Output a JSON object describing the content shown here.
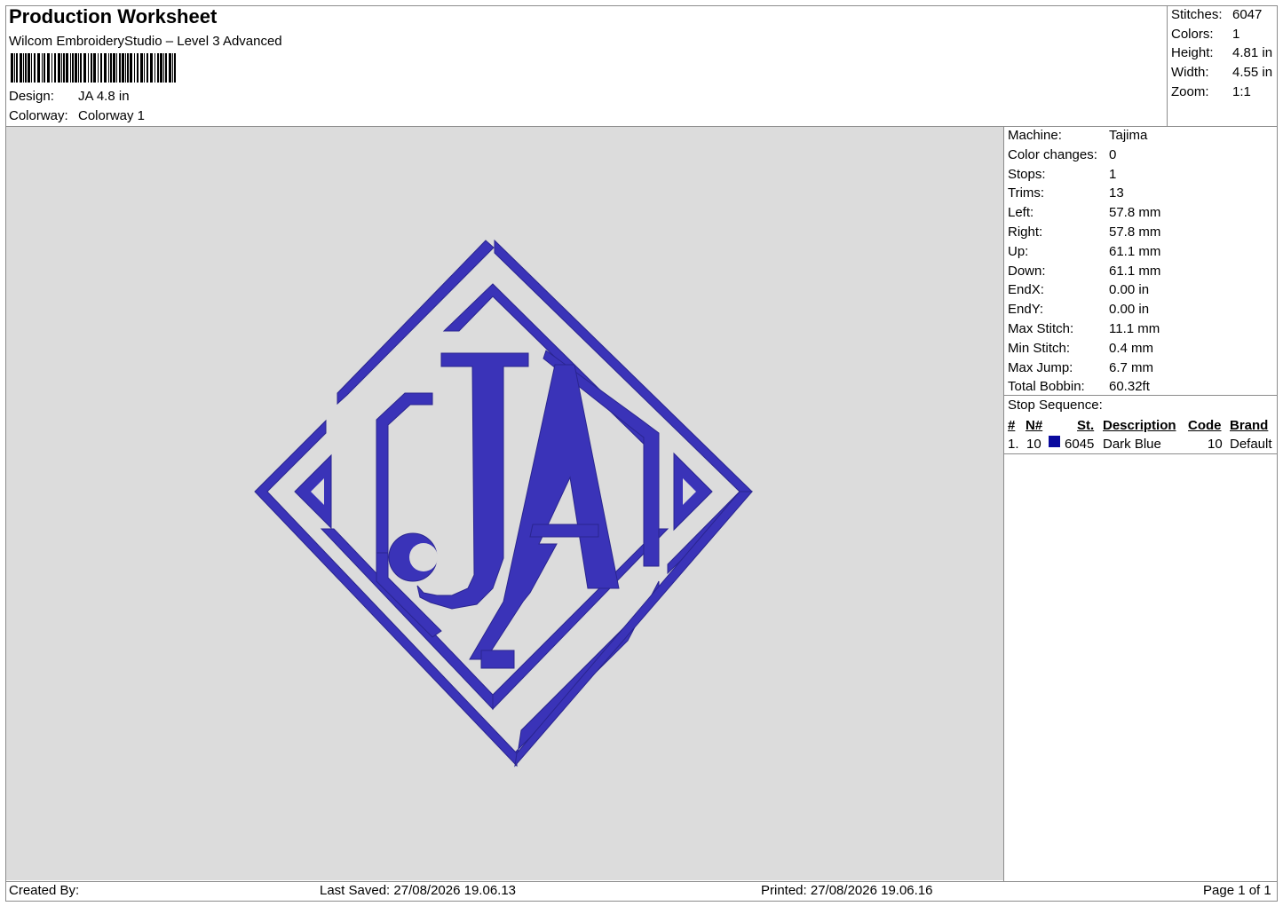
{
  "header": {
    "title": "Production Worksheet",
    "subtitle": "Wilcom EmbroideryStudio – Level 3 Advanced",
    "design_label": "Design:",
    "design_value": "JA 4.8 in",
    "colorway_label": "Colorway:",
    "colorway_value": "Colorway 1"
  },
  "stats": [
    {
      "label": "Stitches:",
      "value": "6047"
    },
    {
      "label": "Colors:",
      "value": "1"
    },
    {
      "label": "Height:",
      "value": "4.81 in"
    },
    {
      "label": "Width:",
      "value": "4.55 in"
    },
    {
      "label": "Zoom:",
      "value": "1:1"
    }
  ],
  "properties": [
    {
      "label": "Machine:",
      "value": "Tajima"
    },
    {
      "label": "Color changes:",
      "value": "0"
    },
    {
      "label": "Stops:",
      "value": "1"
    },
    {
      "label": "Trims:",
      "value": "13"
    },
    {
      "label": "Left:",
      "value": "57.8 mm"
    },
    {
      "label": "Right:",
      "value": "57.8 mm"
    },
    {
      "label": "Up:",
      "value": "61.1 mm"
    },
    {
      "label": "Down:",
      "value": "61.1 mm"
    },
    {
      "label": "EndX:",
      "value": "0.00 in"
    },
    {
      "label": "EndY:",
      "value": "0.00 in"
    },
    {
      "label": "Max Stitch:",
      "value": "11.1 mm"
    },
    {
      "label": "Min Stitch:",
      "value": "0.4 mm"
    },
    {
      "label": "Max Jump:",
      "value": "6.7 mm"
    },
    {
      "label": "Total Bobbin:",
      "value": "60.32ft"
    }
  ],
  "stop_sequence": {
    "heading": "Stop Sequence:",
    "columns": {
      "num": "#",
      "needle": "N#",
      "stitches": "St.",
      "description": "Description",
      "code": "Code",
      "brand": "Brand"
    },
    "rows": [
      {
        "num": "1.",
        "needle": "10",
        "stitches": "6045",
        "description": "Dark Blue",
        "code": "10",
        "brand": "Default",
        "color": "#0a0a9e"
      }
    ]
  },
  "design_preview": {
    "monogram": "JA",
    "thread_color": "#3a33b8",
    "background_color": "#dcdcdc"
  },
  "footer": {
    "created_by": "Created By:",
    "last_saved": "Last Saved: 27/08/2026 19.06.13",
    "printed": "Printed: 27/08/2026 19.06.16",
    "page": "Page 1 of 1"
  }
}
